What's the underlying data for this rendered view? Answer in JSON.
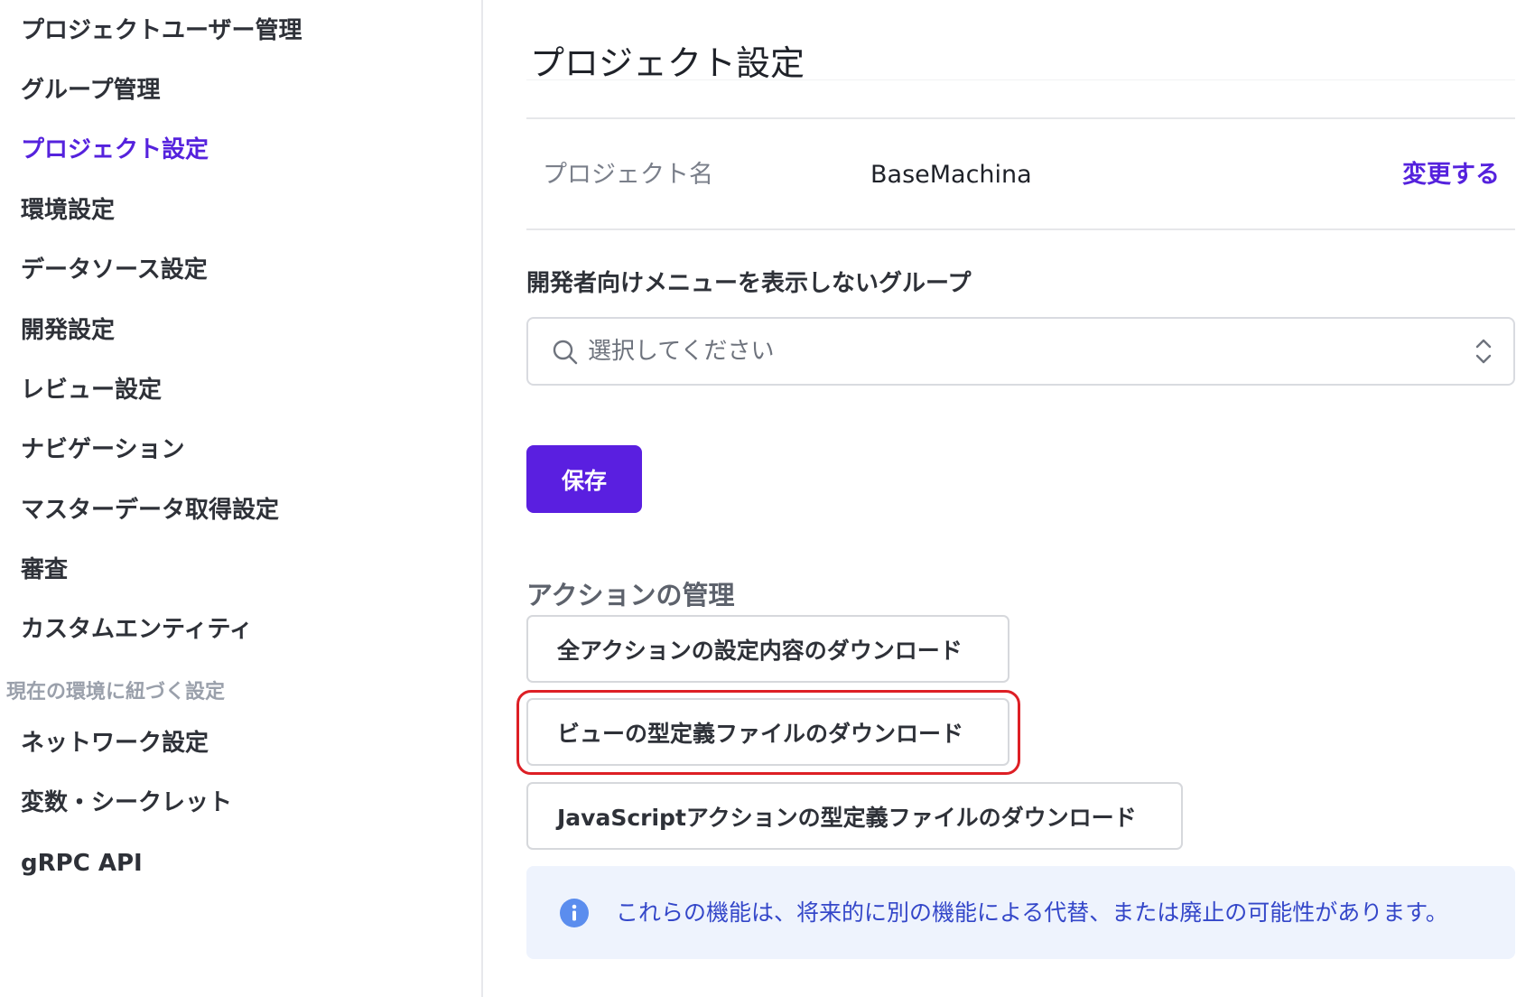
{
  "sidebar": {
    "items": [
      {
        "label": "プロジェクトユーザー管理"
      },
      {
        "label": "グループ管理"
      },
      {
        "label": "プロジェクト設定"
      },
      {
        "label": "環境設定"
      },
      {
        "label": "データソース設定"
      },
      {
        "label": "開発設定"
      },
      {
        "label": "レビュー設定"
      },
      {
        "label": "ナビゲーション"
      },
      {
        "label": "マスターデータ取得設定"
      },
      {
        "label": "審査"
      },
      {
        "label": "カスタムエンティティ"
      }
    ],
    "active_item": "プロジェクト設定",
    "section_title": "現在の環境に紐づく設定",
    "env_items": [
      {
        "label": "ネットワーク設定"
      },
      {
        "label": "変数・シークレット"
      },
      {
        "label": "gRPC API"
      }
    ]
  },
  "main": {
    "title": "プロジェクト設定",
    "project_name": {
      "label": "プロジェクト名",
      "value": "BaseMachina",
      "change_label": "変更する"
    },
    "dev_menu_group": {
      "label": "開発者向けメニューを表示しないグループ",
      "placeholder": "選択してください"
    },
    "save_label": "保存",
    "actions": {
      "heading": "アクションの管理",
      "buttons": [
        {
          "label": "全アクションの設定内容のダウンロード"
        },
        {
          "label": "ビューの型定義ファイルのダウンロード"
        },
        {
          "label": "JavaScriptアクションの型定義ファイルのダウンロード"
        }
      ]
    },
    "notice": {
      "icon": "info-icon",
      "text": "これらの機能は、将来的に別の機能による代替、または廃止の可能性があります。"
    }
  },
  "colors": {
    "accent": "#5522dd",
    "primary_button": "#5a1fe0",
    "highlight": "#dd1f25",
    "notice_bg": "#eef3fd",
    "notice_text": "#3447c9"
  }
}
